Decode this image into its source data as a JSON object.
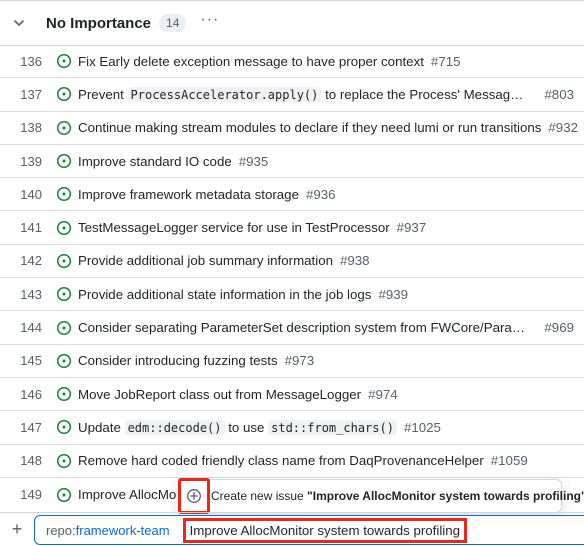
{
  "group": {
    "title": "No Importance",
    "count": "14",
    "more_label": "···"
  },
  "rows": [
    {
      "num": "136",
      "title": "Fix Early delete exception message to have proper context",
      "ref": "#715"
    },
    {
      "num": "137",
      "pre": "Prevent ",
      "code": "ProcessAccelerator.apply()",
      "post": " to replace the Process' MessageLog...",
      "ref": "#803"
    },
    {
      "num": "138",
      "title": "Continue making stream modules to declare if they need lumi or run transitions",
      "ref": "#932"
    },
    {
      "num": "139",
      "title": "Improve standard IO code",
      "ref": "#935"
    },
    {
      "num": "140",
      "title": "Improve framework metadata storage",
      "ref": "#936"
    },
    {
      "num": "141",
      "title": "TestMessageLogger service for use in TestProcessor",
      "ref": "#937"
    },
    {
      "num": "142",
      "title": "Provide additional job summary information",
      "ref": "#938"
    },
    {
      "num": "143",
      "title": "Provide additional state information in the job logs",
      "ref": "#939"
    },
    {
      "num": "144",
      "title": "Consider separating ParameterSet description system from FWCore/Paramet...",
      "ref": "#969"
    },
    {
      "num": "145",
      "title": "Consider introducing fuzzing tests",
      "ref": "#973"
    },
    {
      "num": "146",
      "title": "Move JobReport class out from MessageLogger",
      "ref": "#974"
    },
    {
      "num": "147",
      "pre": "Update ",
      "code": "edm::decode()",
      "mid": " to use ",
      "code2": "std::from_chars()",
      "ref": "#1025"
    },
    {
      "num": "148",
      "title": "Remove hard coded friendly class name from DaqProvenanceHelper",
      "ref": "#1059"
    },
    {
      "num": "149",
      "title": "Improve AllocMo"
    }
  ],
  "tooltip": {
    "prefix": "Create new issue ",
    "quoted_title": "\"Improve AllocMonitor system towards profiling\""
  },
  "add_item": {
    "plus": "+",
    "repo_prefix": "repo:",
    "repo_name": "framework-team",
    "value": "Improve AllocMonitor system towards profiling"
  },
  "colors": {
    "open_issue": "#1a7f37",
    "link": "#0969da",
    "highlight": "#e8281c"
  },
  "icons": {
    "collapse": "chevron-down-icon",
    "issue": "issue-opened-icon",
    "add": "plus-circle-icon"
  }
}
